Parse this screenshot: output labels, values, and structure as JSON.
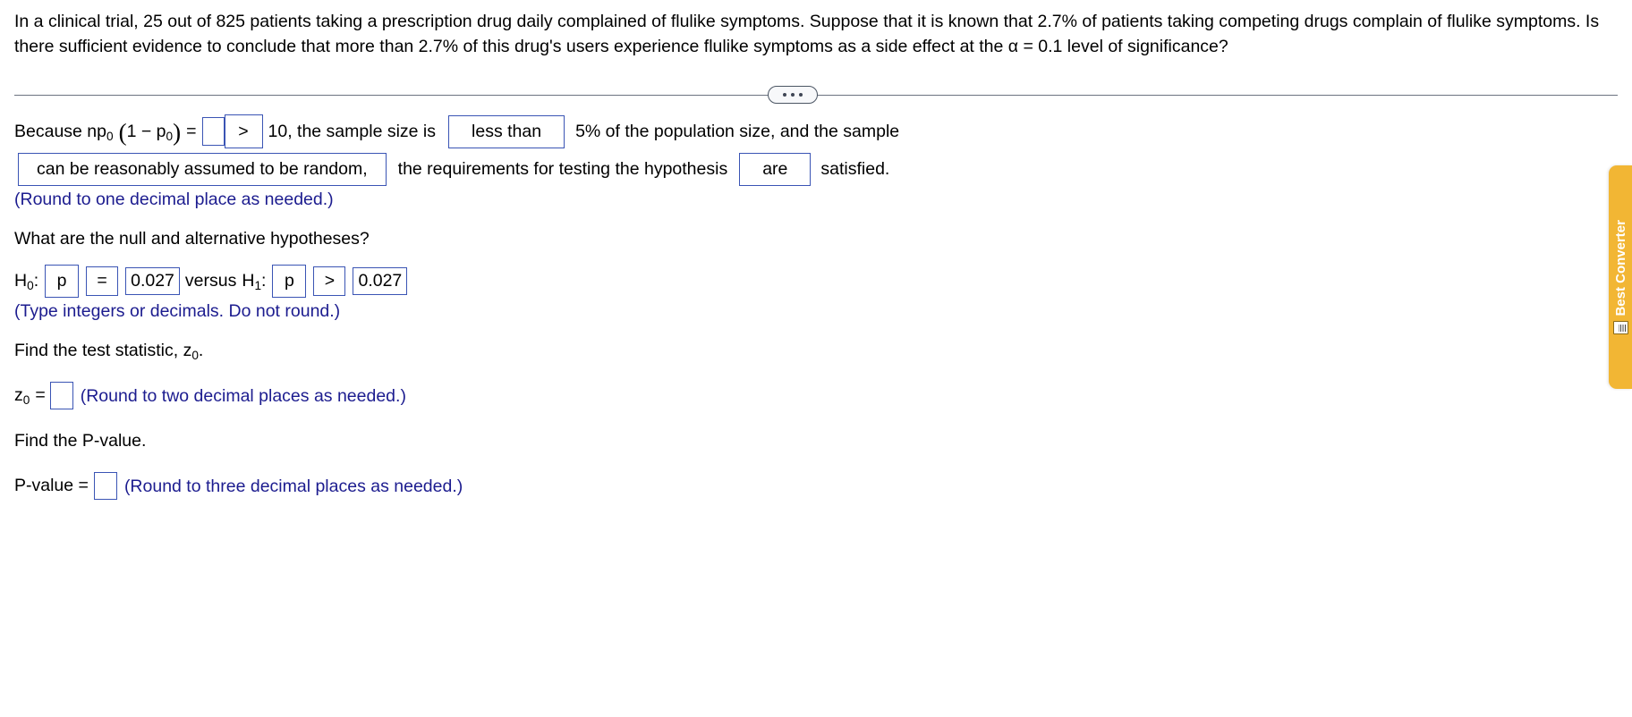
{
  "problem": {
    "text": "In a clinical trial, 25 out of 825 patients taking a prescription drug daily complained of flulike symptoms. Suppose that it is known that 2.7% of patients taking competing drugs complain of flulike symptoms. Is there sufficient evidence to conclude that more than 2.7% of this drug's users experience flulike symptoms as a side effect at the α = 0.1 level of significance?"
  },
  "divider": {
    "ellipsis_label": "•••"
  },
  "requirements": {
    "lead_text": "Because np",
    "lead_sub": "0",
    "paren_open": "(",
    "one_minus": "1 − p",
    "p_sub": "0",
    "paren_close": ")",
    "equals": "=",
    "np_value": "",
    "comparison_operator": ">",
    "threshold_text": "10, the sample size is",
    "sample_size_choice": "less than",
    "percent_text": "5% of the population size, and the sample",
    "random_choice": "can be reasonably assumed to be random,",
    "requirements_text": "the requirements for testing the hypothesis",
    "are_choice": "are",
    "satisfied_text": "satisfied.",
    "hint": "(Round to one decimal place as needed.)"
  },
  "hypotheses": {
    "question": "What are the null and alternative hypotheses?",
    "h0_label": "H",
    "h0_sub": "0",
    "h0_colon": ":",
    "h0_param": "p",
    "h0_operator": "=",
    "h0_value": "0.027",
    "versus": "versus",
    "h1_label": "H",
    "h1_sub": "1",
    "h1_colon": ":",
    "h1_param": "p",
    "h1_operator": ">",
    "h1_value": "0.027",
    "hint": "(Type integers or decimals. Do not round.)"
  },
  "test_statistic": {
    "prompt_pre": "Find the test statistic, z",
    "prompt_sub": "0",
    "prompt_post": ".",
    "z_label": "z",
    "z_sub": "0",
    "equals": "=",
    "value": "",
    "hint": "(Round to two decimal places as needed.)"
  },
  "p_value": {
    "prompt": "Find the P-value.",
    "label": "P-value =",
    "value": "",
    "hint": "(Round to three decimal places as needed.)"
  },
  "side_tab": {
    "label": "Best Converter",
    "icon": "scanner-icon",
    "color": "#f2b634"
  },
  "colors": {
    "answer_box_border": "#3a54b4",
    "hint_text": "#1c1c8f",
    "divider": "#6b7280",
    "text": "#000000"
  }
}
